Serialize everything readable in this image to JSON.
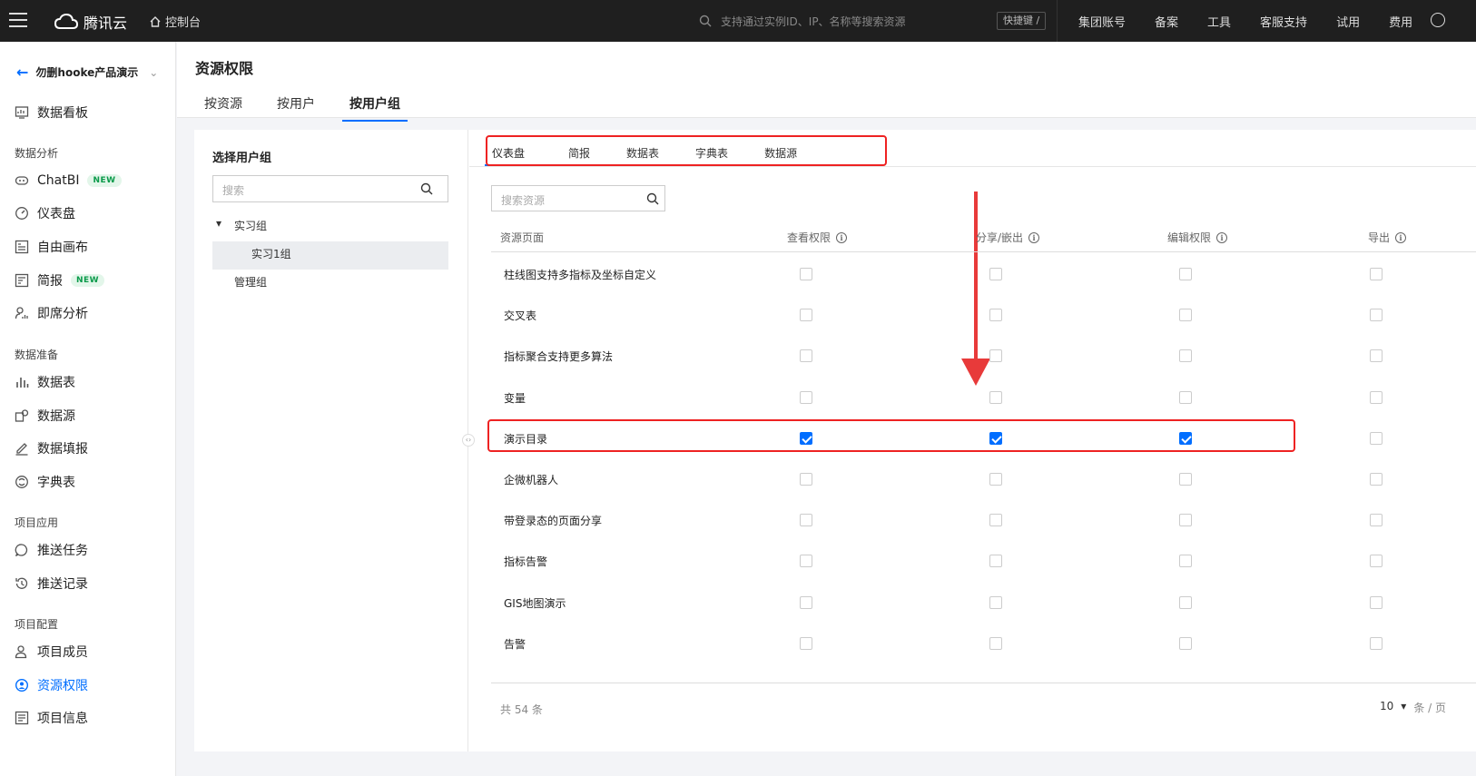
{
  "topbar": {
    "brand": "腾讯云",
    "console": "控制台",
    "search_placeholder": "支持通过实例ID、IP、名称等搜索资源",
    "shortcut": "快捷键 /",
    "nav": [
      "集团账号",
      "备案",
      "工具",
      "客服支持",
      "试用",
      "费用"
    ]
  },
  "sidebar": {
    "project": "勿删hooke产品演示",
    "dashboard": "数据看板",
    "groups": {
      "analysis": "数据分析",
      "prep": "数据准备",
      "app": "项目应用",
      "config": "项目配置"
    },
    "items": {
      "chatbi": "ChatBI",
      "panel": "仪表盘",
      "canvas": "自由画布",
      "brief": "简报",
      "adhoc": "即席分析",
      "table": "数据表",
      "source": "数据源",
      "fill": "数据填报",
      "dict": "字典表",
      "push_task": "推送任务",
      "push_log": "推送记录",
      "members": "项目成员",
      "perm": "资源权限",
      "info": "项目信息"
    },
    "new_badge": "NEW"
  },
  "header": {
    "title": "资源权限",
    "tabs": [
      "按资源",
      "按用户",
      "按用户组"
    ],
    "active_tab": 2
  },
  "left_panel": {
    "title": "选择用户组",
    "search_placeholder": "搜索",
    "tree": {
      "group": "实习组",
      "child": "实习1组",
      "other": "管理组"
    }
  },
  "resource_tabs": [
    "仪表盘",
    "简报",
    "数据表",
    "字典表",
    "数据源"
  ],
  "resource_search_placeholder": "搜索资源",
  "table": {
    "columns": [
      "资源页面",
      "查看权限",
      "分享/嵌出",
      "编辑权限",
      "导出"
    ],
    "rows": [
      {
        "name": "柱线图支持多指标及坐标自定义",
        "perms": [
          false,
          false,
          false,
          false
        ]
      },
      {
        "name": "交叉表",
        "perms": [
          false,
          false,
          false,
          false
        ]
      },
      {
        "name": "指标聚合支持更多算法",
        "perms": [
          false,
          false,
          false,
          false
        ]
      },
      {
        "name": "变量",
        "perms": [
          false,
          false,
          false,
          false
        ]
      },
      {
        "name": "演示目录",
        "perms": [
          true,
          true,
          true,
          false
        ]
      },
      {
        "name": "企微机器人",
        "perms": [
          false,
          false,
          false,
          false
        ]
      },
      {
        "name": "带登录态的页面分享",
        "perms": [
          false,
          false,
          false,
          false
        ]
      },
      {
        "name": "指标告警",
        "perms": [
          false,
          false,
          false,
          false
        ]
      },
      {
        "name": "GIS地图演示",
        "perms": [
          false,
          false,
          false,
          false
        ]
      },
      {
        "name": "告警",
        "perms": [
          false,
          false,
          false,
          false
        ]
      }
    ],
    "total": "共  54  条",
    "page_size": "10",
    "page_size_unit": "条 / 页"
  },
  "colors": {
    "accent": "#006eff",
    "highlight": "#e22222",
    "topbar": "#1f1f1f"
  }
}
